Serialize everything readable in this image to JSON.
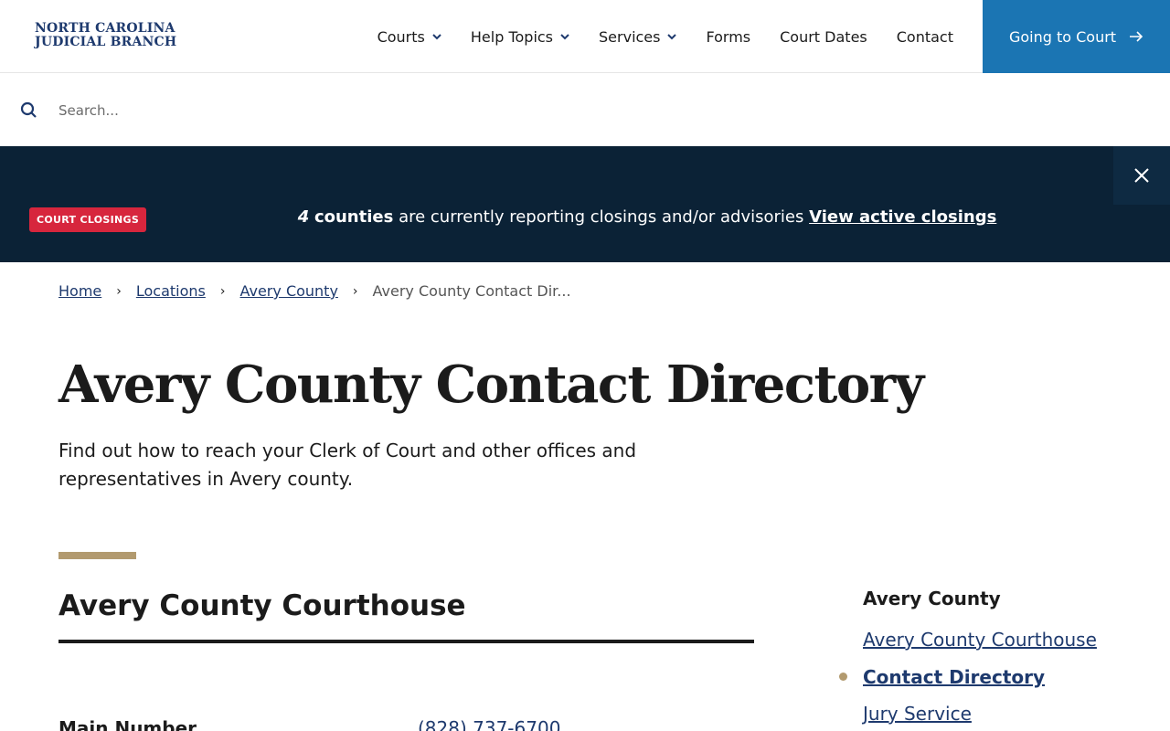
{
  "header": {
    "logo_line1": "NORTH CAROLINA",
    "logo_line2": "JUDICIAL BRANCH",
    "nav": {
      "courts": "Courts",
      "help_topics": "Help Topics",
      "services": "Services",
      "forms": "Forms",
      "court_dates": "Court Dates",
      "contact": "Contact"
    },
    "cta_label": "Going to Court"
  },
  "search": {
    "placeholder": "Search...",
    "value": ""
  },
  "alert": {
    "badge": "COURT CLOSINGS",
    "count": "4",
    "counties": "counties",
    "message": "are currently reporting closings and/or advisories",
    "link": "View active closings"
  },
  "breadcrumb": {
    "home": "Home",
    "locations": "Locations",
    "county": "Avery County",
    "current": "Avery County Contact Dir..."
  },
  "page": {
    "title": "Avery County Contact Directory",
    "intro": "Find out how to reach your Clerk of Court and other offices and representatives in Avery county."
  },
  "section": {
    "title": "Avery County Courthouse",
    "row_label": "Main Number",
    "row_value": "(828) 737-6700"
  },
  "sidenav": {
    "heading": "Avery County",
    "items": [
      "Avery County Courthouse",
      "Contact Directory",
      "Jury Service"
    ]
  },
  "colors": {
    "brand_navy": "#1e3a6e",
    "cta_blue": "#1b75b3",
    "alert_bg": "#0b2236",
    "badge_red": "#d7263d",
    "accent_gold": "#b29a6f"
  }
}
